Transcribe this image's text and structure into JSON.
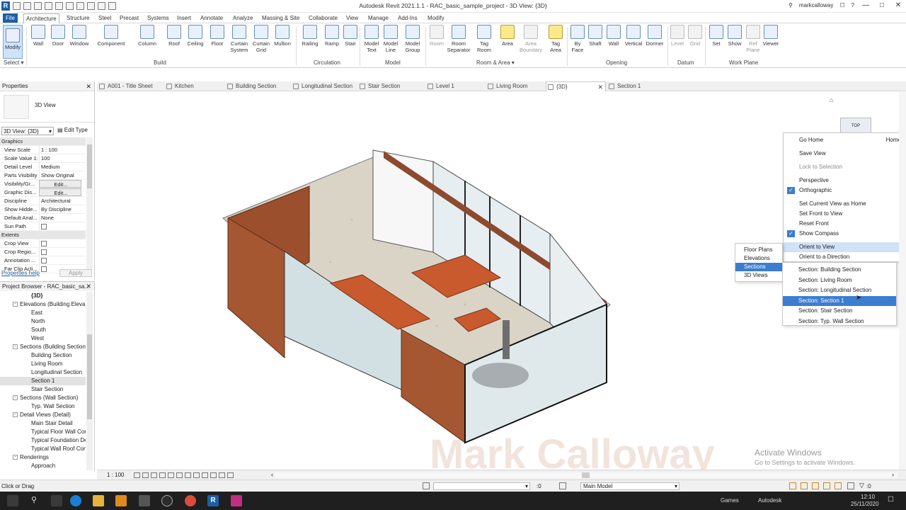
{
  "window": {
    "title": "Autodesk Revit 2021.1.1 - RAC_basic_sample_project - 3D View: {3D}",
    "user": "markcalloway"
  },
  "menu": [
    "File",
    "Architecture",
    "Structure",
    "Steel",
    "Precast",
    "Systems",
    "Insert",
    "Annotate",
    "Analyze",
    "Massing & Site",
    "Collaborate",
    "View",
    "Manage",
    "Add-Ins",
    "Modify"
  ],
  "ribbon": {
    "tools": [
      "Modify",
      "Wall",
      "Door",
      "Window",
      "Component",
      "Column",
      "Roof",
      "Ceiling",
      "Floor",
      "Curtain System",
      "Curtain Grid",
      "Mullion",
      "Railing",
      "Ramp",
      "Stair",
      "Model Text",
      "Model Line",
      "Model Group",
      "Room",
      "Room Separator",
      "Tag Room",
      "Area",
      "Area Boundary",
      "Tag Area",
      "By Face",
      "Shaft",
      "Wall",
      "Vertical",
      "Dormer",
      "Level",
      "Grid",
      "Set",
      "Show",
      "Ref Plane",
      "Viewer"
    ],
    "panels": [
      "Select",
      "Build",
      "Circulation",
      "Model",
      "Room & Area",
      "Opening",
      "Datum",
      "Work Plane"
    ]
  },
  "tabs": [
    "A001 - Title Sheet",
    "Kitchen",
    "Building Section",
    "Longitudinal Section",
    "Stair Section",
    "Level 1",
    "Living Room",
    "{3D}",
    "Section 1"
  ],
  "properties": {
    "title": "Properties",
    "type_name": "3D View",
    "type_selector": "3D View: {3D}",
    "edit_type": "Edit Type",
    "rows": [
      {
        "cat": "Graphics"
      },
      {
        "n": "View Scale",
        "v": "1 : 100"
      },
      {
        "n": "Scale Value 1:",
        "v": "100"
      },
      {
        "n": "Detail Level",
        "v": "Medium"
      },
      {
        "n": "Parts Visibility",
        "v": "Show Original"
      },
      {
        "n": "Visibility/Gr...",
        "v": "Edit...",
        "btn": true
      },
      {
        "n": "Graphic Dis...",
        "v": "Edit...",
        "btn": true
      },
      {
        "n": "Discipline",
        "v": "Architectural"
      },
      {
        "n": "Show Hidde...",
        "v": "By Discipline"
      },
      {
        "n": "Default Anal...",
        "v": "None"
      },
      {
        "n": "Sun Path",
        "v": "",
        "cb": true
      },
      {
        "cat": "Extents"
      },
      {
        "n": "Crop View",
        "v": "",
        "cb": true
      },
      {
        "n": "Crop Regio...",
        "v": "",
        "cb": true
      },
      {
        "n": "Annotation ...",
        "v": "",
        "cb": true
      },
      {
        "n": "Far Clip Acti...",
        "v": "",
        "cb": true
      }
    ],
    "help": "Properties help",
    "apply": "Apply"
  },
  "browser": {
    "title": "Project Browser - RAC_basic_sa...",
    "nodes": [
      {
        "t": "{3D}",
        "i": 2,
        "b": true
      },
      {
        "t": "Elevations (Building Eleva",
        "i": 1,
        "tog": "-"
      },
      {
        "t": "East",
        "i": 2
      },
      {
        "t": "North",
        "i": 2
      },
      {
        "t": "South",
        "i": 2
      },
      {
        "t": "West",
        "i": 2
      },
      {
        "t": "Sections (Building Section",
        "i": 1,
        "tog": "-"
      },
      {
        "t": "Building Section",
        "i": 2
      },
      {
        "t": "Living Room",
        "i": 2
      },
      {
        "t": "Longitudinal Section",
        "i": 2
      },
      {
        "t": "Section 1",
        "i": 2,
        "sel": true
      },
      {
        "t": "Stair Section",
        "i": 2
      },
      {
        "t": "Sections (Wall Section)",
        "i": 1,
        "tog": "-"
      },
      {
        "t": "Typ. Wall Section",
        "i": 2
      },
      {
        "t": "Detail Views (Detail)",
        "i": 1,
        "tog": "-"
      },
      {
        "t": "Main Stair Detail",
        "i": 2
      },
      {
        "t": "Typical Floor Wall Con",
        "i": 2
      },
      {
        "t": "Typical Foundation De",
        "i": 2
      },
      {
        "t": "Typical Wall Roof Con",
        "i": 2
      },
      {
        "t": "Renderings",
        "i": 1,
        "tog": "-"
      },
      {
        "t": "Approach",
        "i": 2
      }
    ]
  },
  "ctx_main": [
    {
      "t": "Go Home",
      "r": "Home"
    },
    {
      "t": "Save View"
    },
    {
      "t": "Lock to Selection",
      "dim": true
    },
    {
      "t": "Perspective"
    },
    {
      "t": "Orthographic",
      "chk": true
    },
    {
      "t": "Set Current View as Home"
    },
    {
      "t": "Set Front to View",
      "arr": true
    },
    {
      "t": "Reset Front"
    },
    {
      "t": "Show Compass",
      "chk": true
    },
    {
      "t": "Orient to View",
      "arr": true,
      "hl": true
    },
    {
      "t": "Orient to a Direction",
      "arr": true
    }
  ],
  "ctx_orient": [
    {
      "t": "Floor Plans"
    },
    {
      "t": "Elevations"
    },
    {
      "t": "Sections",
      "hl": true
    },
    {
      "t": "3D Views"
    }
  ],
  "ctx_sections": [
    {
      "t": "Section: Building Section"
    },
    {
      "t": "Section: Living Room"
    },
    {
      "t": "Section: Longitudinal Section"
    },
    {
      "t": "Section: Section 1",
      "hl": true
    },
    {
      "t": "Section: Stair Section"
    },
    {
      "t": "Section: Typ. Wall Section"
    }
  ],
  "viewcube_label": "TOP",
  "watermark": "Mark Calloway",
  "activate": {
    "l1": "Activate Windows",
    "l2": "Go to Settings to activate Windows."
  },
  "view_scale": "1 : 100",
  "status": {
    "text": "Click or Drag",
    "zero1": ":0",
    "model": "Main Model",
    "zero2": ":0"
  },
  "taskbar": {
    "games": "Games",
    "autodesk": "Autodesk",
    "time": "12:10",
    "date": "25/11/2020"
  }
}
